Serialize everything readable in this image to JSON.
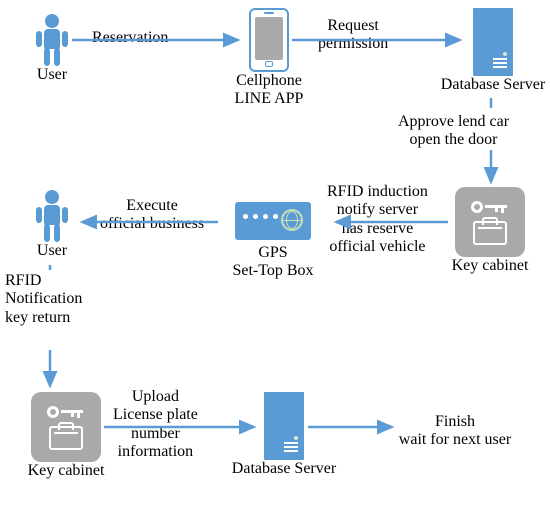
{
  "nodes": {
    "user1": "User",
    "phone": "Cellphone\nLINE APP",
    "server1": "Database Server",
    "key1": "Key cabinet",
    "gps": "GPS\nSet-Top Box",
    "user2": "User",
    "key2": "Key cabinet",
    "server2": "Database Server",
    "finish": "Finish\nwait for next user"
  },
  "edges": {
    "e1": "Reservation",
    "e2": "Request\npermission",
    "e3": "Approve lend car\nopen the door",
    "e4": "RFID induction\nnotify server\nhas reserve\nofficial vehicle",
    "e5": "Execute\nofficial business",
    "e6": "RFID\nNotification\nkey return",
    "e7": "Upload\nLicense plate\nnumber\ninformation"
  }
}
